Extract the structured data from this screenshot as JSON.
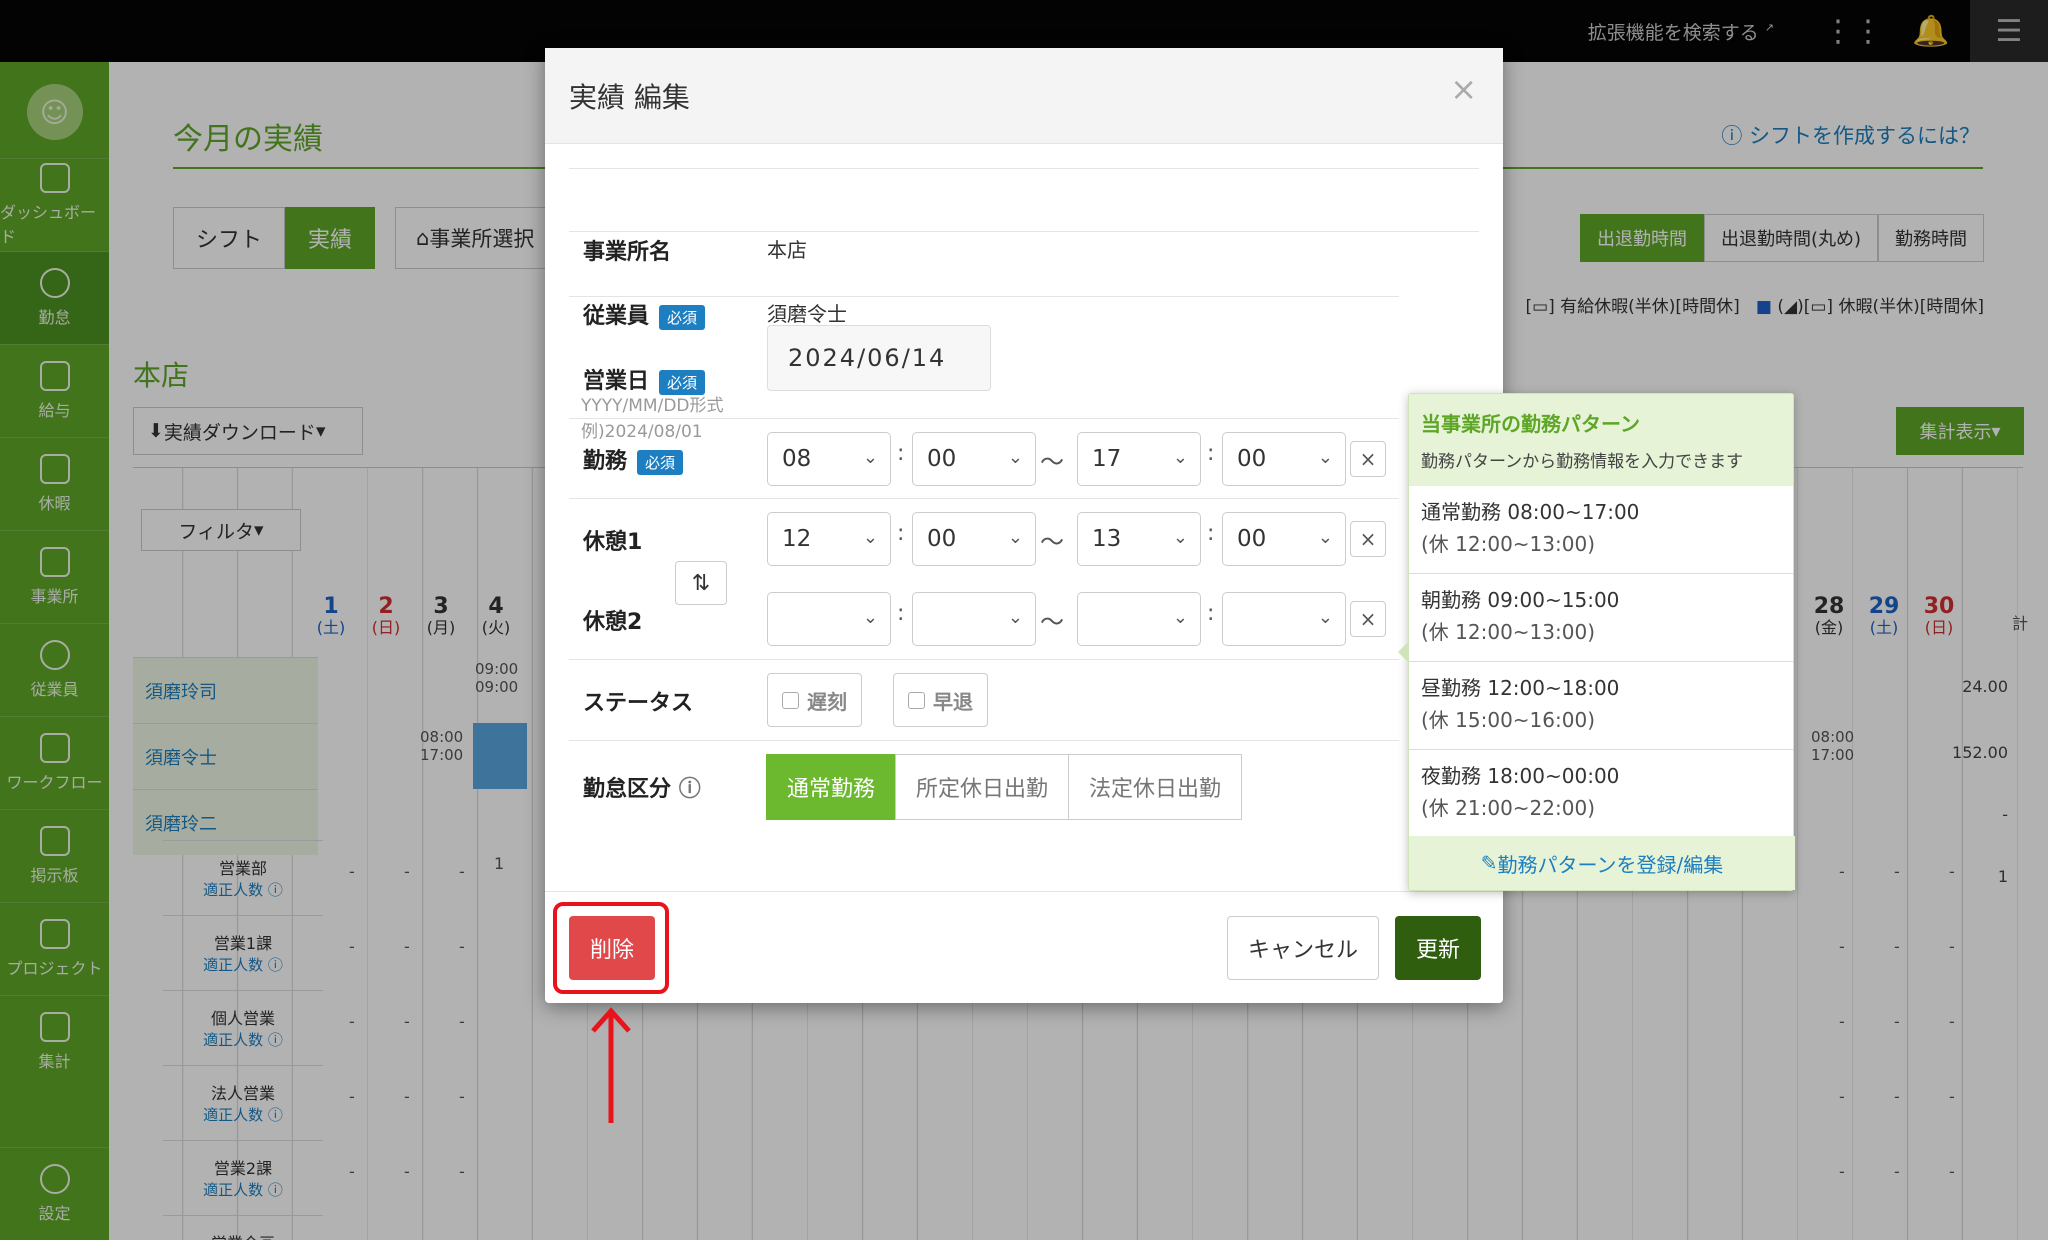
{
  "topbar": {
    "ext_search": "拡張機能を検索する"
  },
  "sidebar": {
    "items": [
      "ダッシュボード",
      "勤怠",
      "給与",
      "休暇",
      "事業所",
      "従業員",
      "ワークフロー",
      "掲示板",
      "プロジェクト",
      "集計"
    ],
    "settings": "設定"
  },
  "page": {
    "title": "今月の実績",
    "help": "シフトを作成するには？",
    "toggle": [
      "シフト",
      "実績"
    ],
    "business_select": "事業所選択",
    "time_tabs": [
      "出退勤時間",
      "出退勤時間(丸め)",
      "勤務時間"
    ],
    "legend_1": "有給休暇(半休)[時間休]",
    "legend_2": "休暇(半休)[時間休]",
    "store": "本店",
    "download": "実績ダウンロード",
    "summary": "集計表示",
    "filter": "フィルタ",
    "days_left": [
      {
        "d": "1",
        "w": "(土)",
        "c": "blue"
      },
      {
        "d": "2",
        "w": "(日)",
        "c": "red"
      },
      {
        "d": "3",
        "w": "(月)",
        "c": ""
      },
      {
        "d": "4",
        "w": "(火)",
        "c": ""
      }
    ],
    "days_right": [
      {
        "d": "28",
        "w": "(金)",
        "c": ""
      },
      {
        "d": "29",
        "w": "(土)",
        "c": "blue"
      },
      {
        "d": "30",
        "w": "(日)",
        "c": "red"
      }
    ],
    "total_header": "計",
    "employees": [
      "須磨玲司",
      "須磨令士",
      "須磨玲二"
    ],
    "emp_totals": [
      "24.00",
      "152.00",
      "-"
    ],
    "cell_4_r1": "09:00\n09:00",
    "cell_3_r2": "08:00\n17:00",
    "cell_28_r2": "08:00\n17:00",
    "depts": [
      "営業部",
      "営業1課",
      "個人営業",
      "法人営業",
      "営業2課",
      "営業企画"
    ],
    "dept_sub": "適正人数",
    "dept1_day4": "1",
    "dept1_total": "1",
    "dash": "-"
  },
  "modal": {
    "title": "実績 編集",
    "close": "×",
    "office_label": "事業所名",
    "office_value": "本店",
    "employee_label": "従業員",
    "required": "必須",
    "employee_value": "須磨令士",
    "date_label": "営業日",
    "date_hint_1": "YYYY/MM/DD形式",
    "date_hint_2": "例)2024/08/01",
    "date_value": "2024/06/14",
    "work_label": "勤務",
    "work": {
      "sh": "08",
      "sm": "00",
      "eh": "17",
      "em": "00"
    },
    "break1_label": "休憩1",
    "break1": {
      "sh": "12",
      "sm": "00",
      "eh": "13",
      "em": "00"
    },
    "break2_label": "休憩2",
    "colon": ":",
    "tilde": "〜",
    "clear": "×",
    "status_label": "ステータス",
    "late": "遅刻",
    "early": "早退",
    "type_label": "勤怠区分",
    "types": [
      "通常勤務",
      "所定休日出勤",
      "法定休日出勤"
    ],
    "delete": "削除",
    "cancel": "キャンセル",
    "update": "更新"
  },
  "popover": {
    "title": "当事業所の勤務パターン",
    "subtitle": "勤務パターンから勤務情報を入力できます",
    "patterns": [
      {
        "name": "通常勤務 08:00~17:00",
        "brk": "(休 12:00~13:00)"
      },
      {
        "name": "朝勤務 09:00~15:00",
        "brk": "(休 12:00~13:00)"
      },
      {
        "name": "昼勤務 12:00~18:00",
        "brk": "(休 15:00~16:00)"
      },
      {
        "name": "夜勤務 18:00~00:00",
        "brk": "(休 21:00~22:00)"
      }
    ],
    "edit_link": "勤務パターンを登録/編集"
  },
  "colors": {
    "brand_green": "#5ea628",
    "update_green": "#2f5e0f",
    "delete_red": "#e0484a",
    "highlight_red": "#e8141b",
    "link_blue": "#1d7fc1"
  }
}
